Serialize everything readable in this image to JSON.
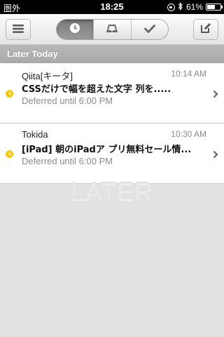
{
  "status_bar": {
    "carrier": "圏外",
    "time": "18:25",
    "battery_percent": "61%",
    "battery_level": 0.61,
    "icons": [
      "rotation-lock-icon",
      "bluetooth-icon",
      "battery-icon"
    ]
  },
  "toolbar": {
    "menu_icon": "menu-icon",
    "segments": [
      {
        "icon": "clock-icon",
        "active": true
      },
      {
        "icon": "tray-icon",
        "active": false
      },
      {
        "icon": "checkmark-icon",
        "active": false
      }
    ],
    "compose_icon": "compose-icon"
  },
  "section": {
    "title": "Later Today"
  },
  "items": [
    {
      "sender": "Qiita[キータ]",
      "time": "10:14 AM",
      "subject": "CSSだけで幅を超えた文字 列を.....",
      "deferred": "Deferred until 6:00 PM"
    },
    {
      "sender": "Tokida",
      "time": "10:30 AM",
      "subject": "[iPad] 朝のiPadア プリ無料セール情...",
      "deferred": "Deferred until 6:00 PM"
    }
  ],
  "empty_watermark": "LATER",
  "colors": {
    "accent_yellow": "#f5c518",
    "section_header": "#acacac",
    "background": "#e2e2e2"
  }
}
